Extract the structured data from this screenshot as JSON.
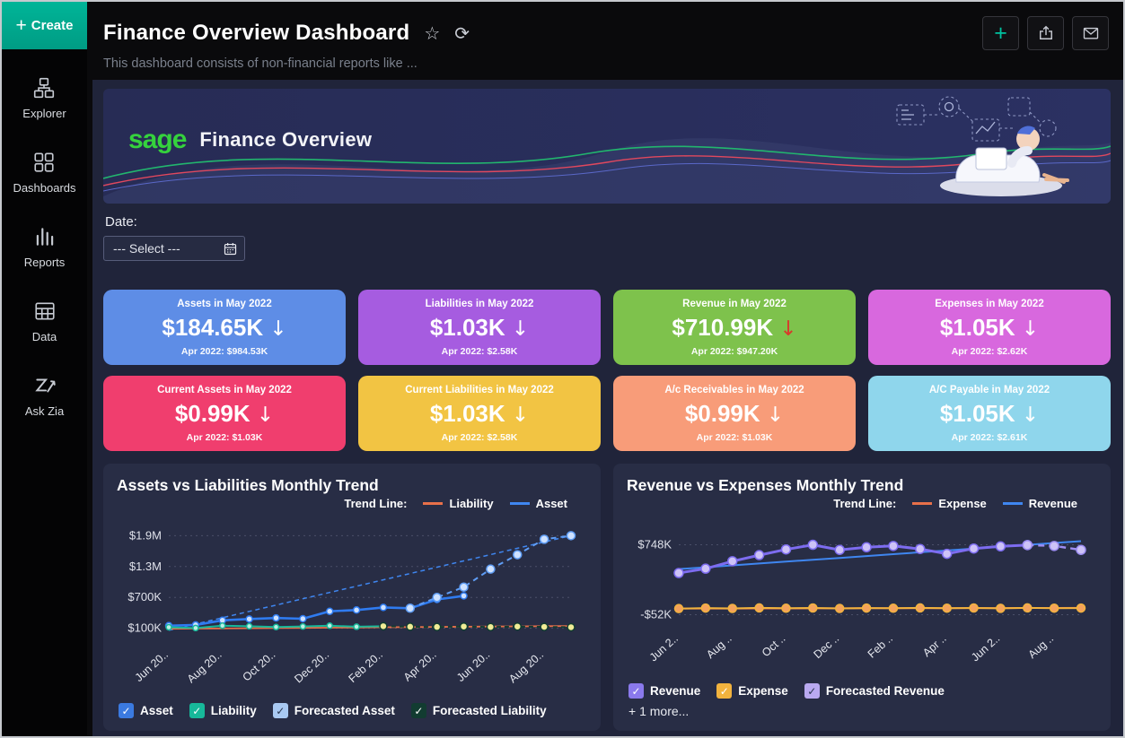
{
  "sidebar": {
    "create": {
      "plus": "+",
      "label": "Create"
    },
    "items": [
      {
        "id": "explorer",
        "label": "Explorer",
        "icon": "explorer-icon"
      },
      {
        "id": "dashboards",
        "label": "Dashboards",
        "icon": "dashboards-icon"
      },
      {
        "id": "reports",
        "label": "Reports",
        "icon": "reports-icon"
      },
      {
        "id": "data",
        "label": "Data",
        "icon": "data-icon"
      },
      {
        "id": "ask-zia",
        "label": "Ask Zia",
        "icon": "ask-zia-icon"
      }
    ]
  },
  "header": {
    "title": "Finance Overview Dashboard",
    "subtitle": "This dashboard consists of non-financial reports like ...",
    "star_icon": "☆",
    "refresh_icon": "⟳",
    "actions": [
      {
        "id": "add",
        "icon": "plus-icon",
        "glyph": "+"
      },
      {
        "id": "export",
        "icon": "export-icon"
      },
      {
        "id": "email",
        "icon": "email-icon"
      }
    ]
  },
  "banner": {
    "brand": "sage",
    "brand_color": "#35d23d",
    "title": "Finance Overview"
  },
  "date_filter": {
    "label": "Date:",
    "value": "--- Select ---"
  },
  "kpi_cards": [
    {
      "title": "Assets in May 2022",
      "value": "$184.65K",
      "arrow": "↓",
      "arrow_color": "#ffffff",
      "footnote": "Apr 2022: $984.53K",
      "color": "#5e8de6"
    },
    {
      "title": "Liabilities in May 2022",
      "value": "$1.03K",
      "arrow": "↓",
      "arrow_color": "#ffffff",
      "footnote": "Apr 2022: $2.58K",
      "color": "#a65ce0"
    },
    {
      "title": "Revenue in May 2022",
      "value": "$710.99K",
      "arrow": "↓",
      "arrow_color": "#d8392b",
      "footnote": "Apr 2022: $947.20K",
      "color": "#7ec24c"
    },
    {
      "title": "Expenses in May 2022",
      "value": "$1.05K",
      "arrow": "↓",
      "arrow_color": "#ffffff",
      "footnote": "Apr 2022: $2.62K",
      "color": "#d868de"
    },
    {
      "title": "Current Assets in May 2022",
      "value": "$0.99K",
      "arrow": "↓",
      "arrow_color": "#ffffff",
      "footnote": "Apr 2022: $1.03K",
      "color": "#f03e6e"
    },
    {
      "title": "Current Liabilities in May 2022",
      "value": "$1.03K",
      "arrow": "↓",
      "arrow_color": "#ffffff",
      "footnote": "Apr 2022: $2.58K",
      "color": "#f2c443"
    },
    {
      "title": "A/c Receivables in May 2022",
      "value": "$0.99K",
      "arrow": "↓",
      "arrow_color": "#ffffff",
      "footnote": "Apr 2022: $1.03K",
      "color": "#f89c79"
    },
    {
      "title": "A/C Payable in May 2022",
      "value": "$1.05K",
      "arrow": "↓",
      "arrow_color": "#ffffff",
      "footnote": "Apr 2022: $2.61K",
      "color": "#8fd6ec"
    }
  ],
  "charts": [
    {
      "title": "Assets vs Liabilities Monthly Trend",
      "trend_legend": {
        "label": "Trend Line:",
        "items": [
          {
            "name": "Liability",
            "color": "#e8704a"
          },
          {
            "name": "Asset",
            "color": "#3f86f0"
          }
        ]
      },
      "checkboxes": [
        {
          "label": "Asset",
          "color": "#3b7ae0",
          "check": "#ffffff"
        },
        {
          "label": "Liability",
          "color": "#17b89a",
          "check": "#ffffff"
        },
        {
          "label": "Forecasted Asset",
          "color": "#a9c9f2",
          "check": "#27354f"
        },
        {
          "label": "Forecasted Liability",
          "color": "#123c31",
          "check": "#ffffff"
        }
      ],
      "chart_data": {
        "type": "line",
        "unit": "USD thousands",
        "n_points": 16,
        "x_tick_idx": [
          0,
          2,
          4,
          6,
          8,
          10,
          12,
          14
        ],
        "x_ticks": [
          "Jun 20..",
          "Aug 20..",
          "Oct 20..",
          "Dec 20..",
          "Feb 20..",
          "Apr 20..",
          "Jun 20..",
          "Aug 20.."
        ],
        "y_ticks": [
          {
            "label": "$1.9M",
            "value": 1900
          },
          {
            "label": "$1.3M",
            "value": 1300
          },
          {
            "label": "$700K",
            "value": 700
          },
          {
            "label": "$100K",
            "value": 100
          }
        ],
        "ylim": [
          -150,
          2150
        ],
        "series": [
          {
            "name": "Asset Trend",
            "color": "#3f86f0",
            "width": 1.5,
            "dash": "5,4",
            "trend": [
              60,
              1900
            ]
          },
          {
            "name": "Liability Trend",
            "color": "#e8704a",
            "width": 1.8,
            "trend": [
              90,
              145
            ]
          },
          {
            "name": "Asset",
            "color": "#2f7bf0",
            "width": 2.6,
            "marker": true,
            "marker_r": 3.5,
            "marker_fill": "#cfe2ff",
            "values": [
              150,
              165,
              255,
              280,
              300,
              285,
              430,
              455,
              505,
              490,
              660,
              730,
              null,
              null,
              null,
              null
            ]
          },
          {
            "name": "Forecasted Asset",
            "color": "#5f9df5",
            "width": 2,
            "dash": "6,5",
            "marker": true,
            "marker_r": 4.5,
            "marker_fill": "#cfe2ff",
            "values": [
              null,
              null,
              null,
              null,
              null,
              null,
              null,
              null,
              null,
              490,
              700,
              900,
              1250,
              1530,
              1830,
              1900
            ]
          },
          {
            "name": "Liability",
            "color": "#17b89a",
            "width": 2,
            "marker": true,
            "marker_r": 3,
            "marker_fill": "#bdf0e4",
            "values": [
              120,
              105,
              150,
              140,
              125,
              135,
              150,
              130,
              140,
              null,
              null,
              null,
              null,
              null,
              null,
              null
            ]
          },
          {
            "name": "Forecasted Liability",
            "color": "#123c31",
            "width": 2,
            "dash": "5,4",
            "marker": true,
            "marker_r": 4,
            "marker_fill": "#f0ec96",
            "values": [
              null,
              null,
              null,
              null,
              null,
              null,
              null,
              null,
              140,
              130,
              126,
              134,
              125,
              134,
              127,
              121
            ]
          }
        ]
      }
    },
    {
      "title": "Revenue vs Expenses Monthly Trend",
      "trend_legend": {
        "label": "Trend Line:",
        "items": [
          {
            "name": "Expense",
            "color": "#e8704a"
          },
          {
            "name": "Revenue",
            "color": "#3f86f0"
          }
        ]
      },
      "checkboxes": [
        {
          "label": "Revenue",
          "color": "#8a79ec",
          "check": "#ffffff"
        },
        {
          "label": "Expense",
          "color": "#f2b33e",
          "check": "#ffffff"
        },
        {
          "label": "Forecasted Revenue",
          "color": "#b9a9f0",
          "check": "#27354f"
        }
      ],
      "more_label": "+ 1 more...",
      "chart_data": {
        "type": "line",
        "unit": "USD thousands",
        "n_points": 16,
        "x_tick_idx": [
          0,
          2,
          4,
          6,
          8,
          10,
          12,
          14
        ],
        "x_ticks": [
          "Jun 2..",
          "Aug ..",
          "Oct ..",
          "Dec ..",
          "Feb ..",
          "Apr ..",
          "Jun 2..",
          "Aug .."
        ],
        "y_ticks": [
          {
            "label": "$748K",
            "value": 748
          },
          {
            "label": "-$52K",
            "value": -52
          }
        ],
        "ylim": [
          -170,
          1000
        ],
        "series": [
          {
            "name": "Revenue Trend",
            "color": "#3f86f0",
            "width": 2,
            "trend": [
              470,
              790
            ]
          },
          {
            "name": "Expense Trend",
            "color": "#e8704a",
            "width": 2,
            "trend": [
              18,
              26
            ]
          },
          {
            "name": "Revenue",
            "color": "#7d6cf0",
            "width": 3,
            "marker": true,
            "marker_r": 5,
            "marker_fill": "#cdc2f7",
            "values": [
              425,
              475,
              560,
              630,
              695,
              748,
              690,
              720,
              735,
              700,
              645,
              705,
              730,
              745,
              null,
              null
            ]
          },
          {
            "name": "Forecasted Revenue",
            "color": "#9d8df2",
            "width": 2.5,
            "dash": "7,5",
            "marker": true,
            "marker_r": 5,
            "marker_fill": "#cdc2f7",
            "values": [
              null,
              null,
              null,
              null,
              null,
              null,
              null,
              null,
              null,
              null,
              null,
              null,
              null,
              745,
              735,
              690
            ]
          },
          {
            "name": "Expense",
            "color": "#f2b33e",
            "width": 2,
            "marker": true,
            "marker_r": 4.5,
            "marker_fill": "#f5a25c",
            "values": [
              18,
              24,
              20,
              26,
              22,
              25,
              20,
              24,
              22,
              26,
              23,
              25,
              21,
              26,
              23,
              24
            ]
          }
        ]
      }
    }
  ]
}
